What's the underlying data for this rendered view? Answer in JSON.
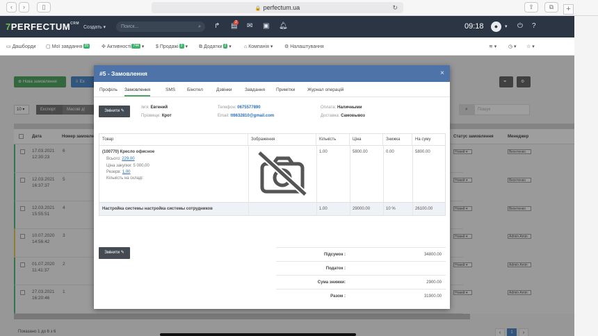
{
  "browser": {
    "url": "perfectum.ua"
  },
  "header": {
    "logo_mark": "7",
    "logo_text": "PERFECTUM",
    "logo_sup": "CRM",
    "create_label": "Создать ▾",
    "search_placeholder": "Поиск...",
    "notification_count": "2",
    "time": "09:18"
  },
  "nav": {
    "items": [
      {
        "label": "Дашборди",
        "badge": ""
      },
      {
        "label": "Мої завдання",
        "badge": "25"
      },
      {
        "label": "Активності",
        "badge": "744"
      },
      {
        "label": "Продажі",
        "badge": "2"
      },
      {
        "label": "Додатки",
        "badge": "2"
      },
      {
        "label": "Компанія",
        "badge": ""
      },
      {
        "label": "Налаштування",
        "badge": ""
      }
    ]
  },
  "background": {
    "new_order_label": "Нова замовлення",
    "export_label": "Експорт",
    "massact_label": "Масові ді",
    "page_size": "10",
    "search_placeholder": "Пошук",
    "columns": [
      "Дата",
      "Номер замовлення",
      "Статус замовлення",
      "Менеджер"
    ],
    "rows": [
      {
        "date": "17.03.2021",
        "time": "12:30:23",
        "num": "6",
        "status": "Новий",
        "manager": "Вконтенко"
      },
      {
        "date": "12.03.2021",
        "time": "16:37:37",
        "num": "5",
        "status": "Новий",
        "manager": "Вконтенко"
      },
      {
        "date": "12.03.2021",
        "time": "15:55:51",
        "num": "4",
        "status": "Новий",
        "manager": "Вконтенко"
      },
      {
        "date": "10.07.2020",
        "time": "14:56:42",
        "num": "3",
        "status": "Новий",
        "manager": "Admin Amin"
      },
      {
        "date": "01.07.2020",
        "time": "11:41:37",
        "num": "2",
        "status": "Новий",
        "manager": "Admin Amin"
      },
      {
        "date": "27.03.2021",
        "time": "16:20:46",
        "num": "1",
        "status": "Новий",
        "manager": "Admin Amin"
      }
    ],
    "footer_text": "Показано 1 до 6 з 6",
    "page_current": "1"
  },
  "modal": {
    "title": "#5 - Замовлення",
    "close": "×",
    "tabs": [
      "Профіль",
      "Замовлення",
      "SMS",
      "Бінотел",
      "Дзвінки",
      "Завдання",
      "Примітки",
      "Журнал операцій"
    ],
    "edit_label": "Змінити",
    "customer": {
      "name_label": "Ім'я:",
      "name": "Евгений",
      "surname_label": "Прізвище:",
      "surname": "Крот",
      "phone_label": "Телефон:",
      "phone": "0675577890",
      "email_label": "Email:",
      "email": "tt6632810@gmail.com",
      "payment_label": "Оплата:",
      "payment": "Наличными",
      "delivery_label": "Доставка:",
      "delivery": "Самовывоз"
    },
    "table": {
      "headers": [
        "Товар",
        "Зображення",
        "Кількість",
        "Ціна",
        "Знижка",
        "На суму"
      ],
      "rows": [
        {
          "product": "(100770) Кресло офисное",
          "details": [
            {
              "label": "Всього:",
              "value": "229,00"
            },
            {
              "label": "Ціна закупки:",
              "value": "5 000,00"
            },
            {
              "label": "Резерв:",
              "value": "1,00"
            },
            {
              "label": "Кількість на складі:",
              "value": ""
            }
          ],
          "qty": "1.00",
          "price": "5800.00",
          "discount": "0.00",
          "sum": "5800.00"
        },
        {
          "product": "Настройка системы настройка системы сотрудников",
          "qty": "1.00",
          "price": "29000.00",
          "discount": "10 %",
          "sum": "26100.00"
        }
      ]
    },
    "totals": [
      {
        "label": "Підсумок :",
        "value": "34800.00"
      },
      {
        "label": "Податок :",
        "value": ""
      },
      {
        "label": "Сума знижки:",
        "value": "2900.00"
      },
      {
        "label": "Разом :",
        "value": "31900.00"
      }
    ]
  }
}
